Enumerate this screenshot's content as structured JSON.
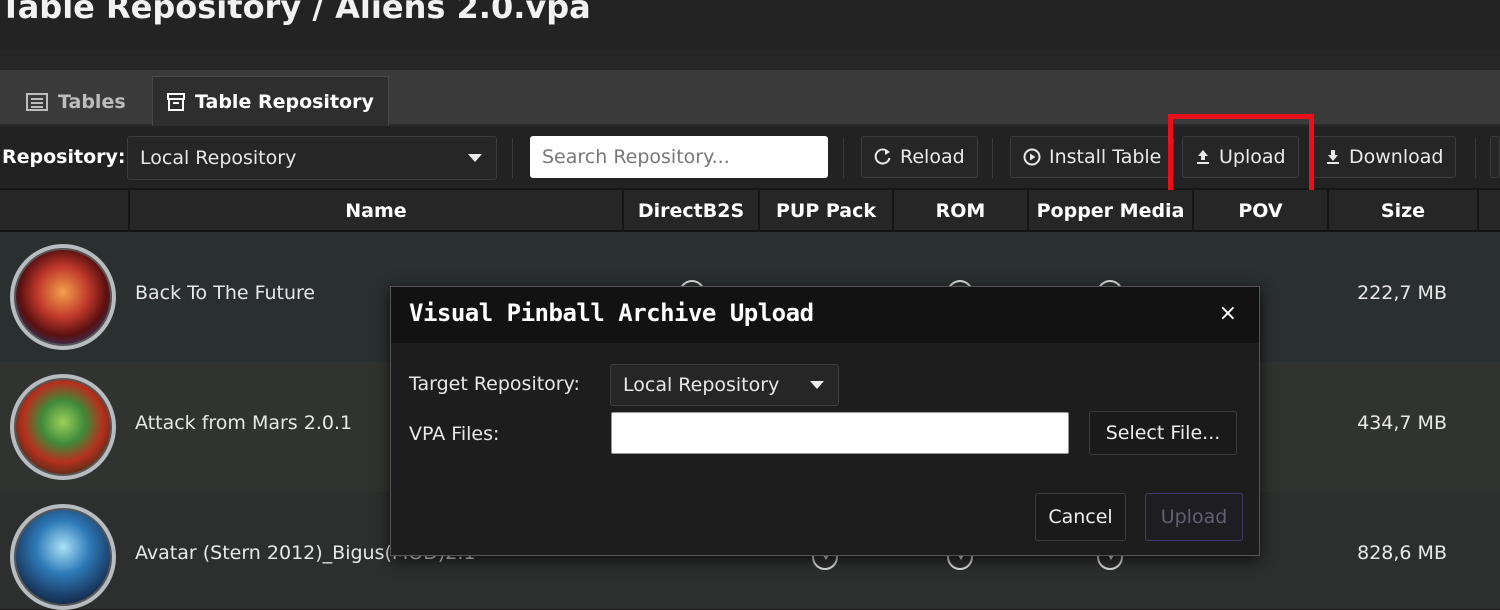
{
  "window": {
    "title": "Table Repository / Aliens 2.0.vpa"
  },
  "tabs": [
    {
      "label": "Tables",
      "icon": "list-icon",
      "active": false
    },
    {
      "label": "Table Repository",
      "icon": "archive-icon",
      "active": true
    }
  ],
  "toolbar": {
    "repository_label": "Repository:",
    "repository_value": "Local Repository",
    "search_placeholder": "Search Repository...",
    "reload_label": "Reload",
    "install_label": "Install Table",
    "upload_label": "Upload",
    "download_label": "Download"
  },
  "table": {
    "columns": [
      "Name",
      "DirectB2S",
      "PUP Pack",
      "ROM",
      "Popper Media",
      "POV",
      "Size"
    ],
    "rows": [
      {
        "name": "Back To The Future",
        "size": "222,7 MB"
      },
      {
        "name": "Attack from Mars 2.0.1",
        "size": "434,7 MB"
      },
      {
        "name": "Avatar (Stern 2012)_Bigus(MOD)2.1",
        "size": "828,6 MB"
      }
    ]
  },
  "dialog": {
    "title": "Visual Pinball Archive Upload",
    "close": "×",
    "target_repo_label": "Target Repository:",
    "target_repo_value": "Local Repository",
    "vpa_files_label": "VPA Files:",
    "vpa_files_value": "",
    "select_file_label": "Select File...",
    "cancel_label": "Cancel",
    "upload_label": "Upload"
  },
  "colors": {
    "highlight": "#e8111b",
    "background": "#1c1c1c",
    "accent_disabled_border": "#3f3c6c"
  }
}
